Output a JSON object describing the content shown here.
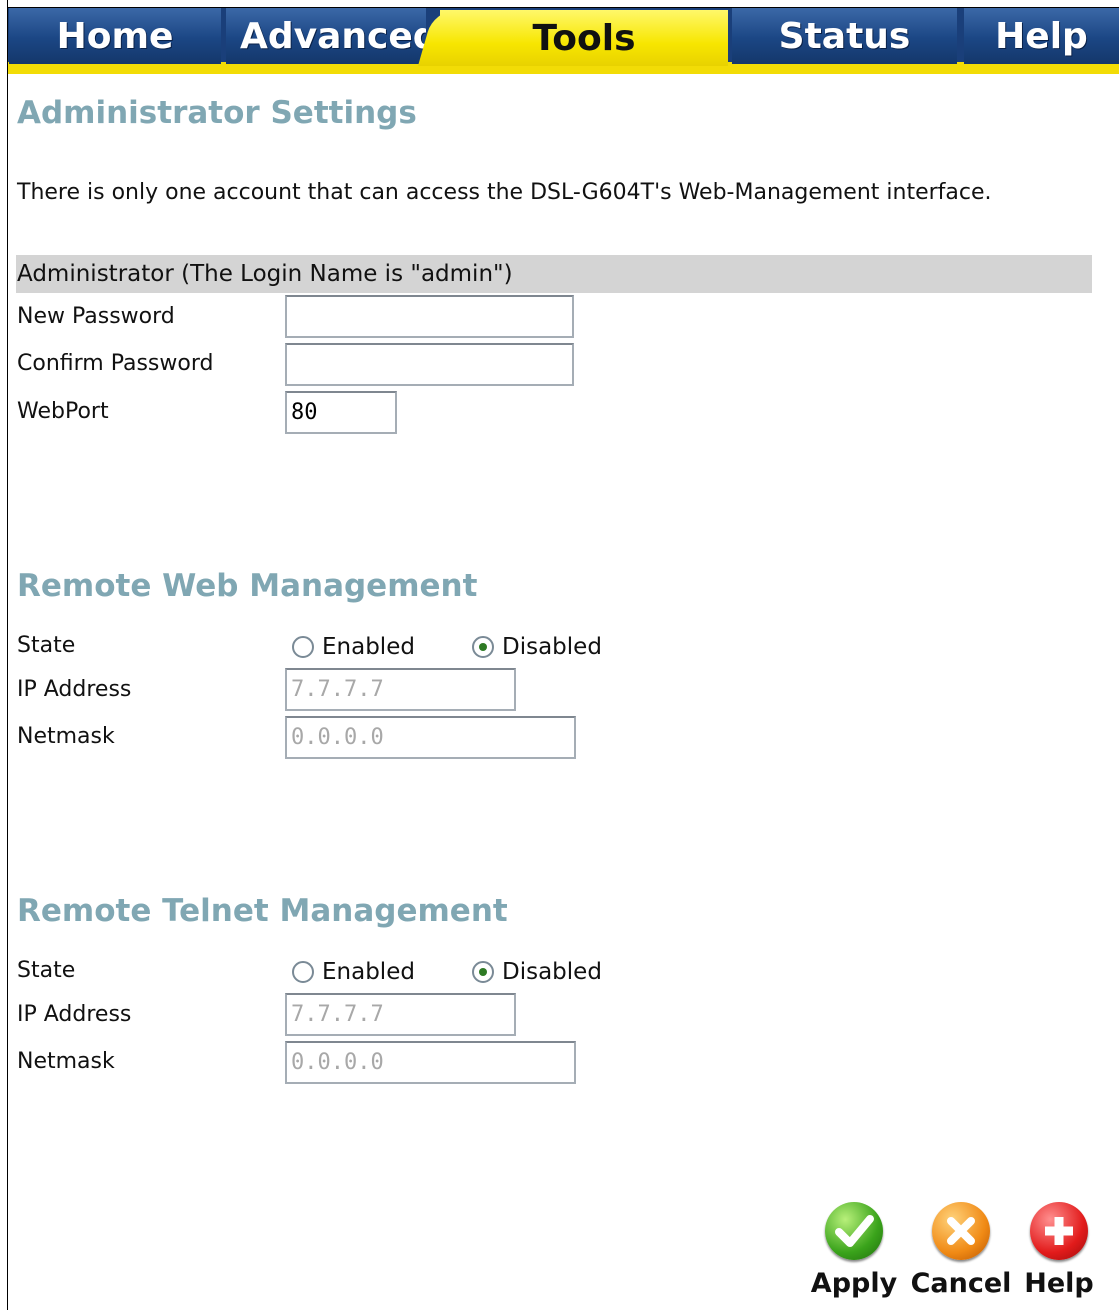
{
  "nav": {
    "tabs": [
      {
        "label": "Home"
      },
      {
        "label": "Advanced"
      },
      {
        "label": "Tools"
      },
      {
        "label": "Status"
      },
      {
        "label": "Help"
      }
    ],
    "active_tab": "Tools"
  },
  "admin": {
    "title": "Administrator Settings",
    "description": "There is only one account that can access the DSL-G604T's Web-Management interface.",
    "section_header": "Administrator (The Login Name is \"admin\")",
    "new_password_label": "New Password",
    "new_password_value": "",
    "confirm_password_label": "Confirm Password",
    "confirm_password_value": "",
    "webport_label": "WebPort",
    "webport_value": "80"
  },
  "remote_web": {
    "title": "Remote Web Management",
    "state_label": "State",
    "enabled_label": "Enabled",
    "disabled_label": "Disabled",
    "state": "Disabled",
    "ip_label": "IP Address",
    "ip_value": "7.7.7.7",
    "netmask_label": "Netmask",
    "netmask_value": "0.0.0.0"
  },
  "remote_telnet": {
    "title": "Remote Telnet Management",
    "state_label": "State",
    "enabled_label": "Enabled",
    "disabled_label": "Disabled",
    "state": "Disabled",
    "ip_label": "IP Address",
    "ip_value": "7.7.7.7",
    "netmask_label": "Netmask",
    "netmask_value": "0.0.0.0"
  },
  "actions": {
    "apply_label": "Apply",
    "cancel_label": "Cancel",
    "help_label": "Help",
    "apply_icon": "checkmark-icon",
    "cancel_icon": "x-icon",
    "help_icon": "plus-icon"
  },
  "colors": {
    "nav_blue": "#1b4684",
    "nav_active_yellow": "#f7e600",
    "heading_teal": "#80a7b3",
    "section_bar_gray": "#d4d4d4"
  }
}
